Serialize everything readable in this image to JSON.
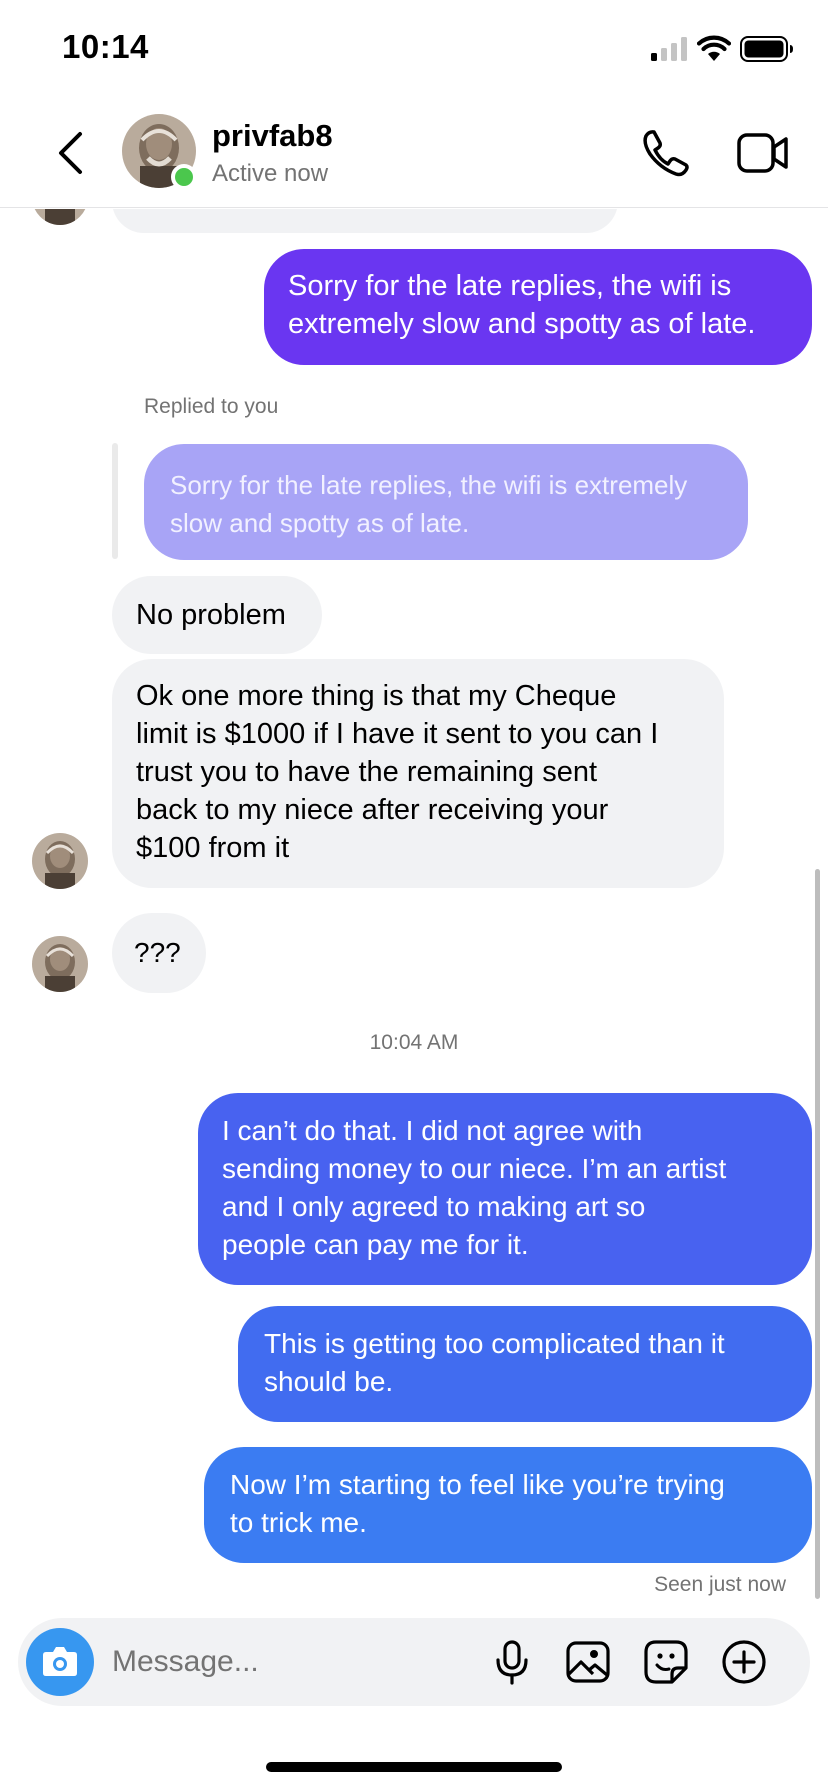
{
  "status_bar": {
    "time": "10:14"
  },
  "header": {
    "contact_name": "privfab8",
    "contact_status": "Active now",
    "online": true
  },
  "messages": [
    {
      "id": "m1",
      "direction": "outgoing",
      "text": "Sorry for the late replies, the wifi is\nextremely slow and spotty as of late.",
      "color": "#6a36f1"
    },
    {
      "id": "m2",
      "direction": "incoming",
      "reply_label": "Replied to you",
      "quoted_text": "Sorry for the late replies, the wifi is extremely\nslow and spotty as of late.",
      "text": "No problem"
    },
    {
      "id": "m3",
      "direction": "incoming",
      "text": "Ok one more thing is that my Cheque\nlimit is $1000 if I have it sent to you can I\ntrust you to have the remaining sent\nback to my niece after receiving your\n$100 from  it"
    },
    {
      "id": "m4",
      "direction": "incoming",
      "text": "???"
    },
    {
      "id": "m5",
      "direction": "outgoing",
      "text": "I can’t do that. I did not agree with\nsending money to our niece. I’m an artist\nand I only agreed to making art so\npeople can pay me for it.",
      "color": "#4862f0"
    },
    {
      "id": "m6",
      "direction": "outgoing",
      "text": "This is getting too complicated than it\nshould be.",
      "color": "#416cf0"
    },
    {
      "id": "m7",
      "direction": "outgoing",
      "text": "Now I’m starting to feel like you’re trying\nto trick me.",
      "color": "#3b7cf2"
    }
  ],
  "timestamp": "10:04 AM",
  "seen": "Seen just now",
  "composer": {
    "placeholder": "Message..."
  },
  "colors": {
    "accent": "#3797f0",
    "online": "#4bc74d",
    "incoming_bubble": "#f1f2f4",
    "quoted_bubble": "#a8a4f6"
  },
  "icons": {
    "back": "chevron-left-icon",
    "call": "phone-icon",
    "video": "video-camera-icon",
    "camera": "camera-icon",
    "mic": "microphone-icon",
    "gallery": "image-icon",
    "sticker": "sticker-icon",
    "more": "plus-circle-icon"
  }
}
